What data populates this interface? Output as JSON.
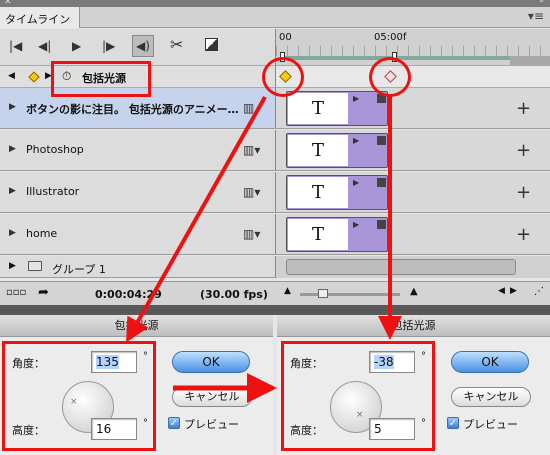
{
  "panel": {
    "title": "タイムライン",
    "menu_icon": "panel-menu-icon"
  },
  "controls": {
    "icons": [
      "go-first-icon",
      "step-back-icon",
      "play-icon",
      "step-forward-icon",
      "audio-icon",
      "cut-icon",
      "transition-icon"
    ]
  },
  "ruler": {
    "start": "00",
    "mark": "05:00f"
  },
  "property_row": {
    "label": "包括光源"
  },
  "layers": [
    {
      "name": "ボタンの影に注目。 包括光源のアニメー…",
      "selected": true,
      "thumb": "T"
    },
    {
      "name": "Photoshop",
      "selected": false,
      "thumb": "T"
    },
    {
      "name": "Illustrator",
      "selected": false,
      "thumb": "T"
    },
    {
      "name": "home",
      "selected": false,
      "thumb": "T"
    }
  ],
  "group": {
    "name": "グループ 1"
  },
  "status": {
    "time": "0:00:04:29",
    "fps": "(30.00 fps)"
  },
  "dialog_left": {
    "title": "包括光源",
    "angle_label": "角度：",
    "angle_value": "135",
    "altitude_label": "高度：",
    "altitude_value": "16",
    "degree": "°",
    "ok": "OK",
    "cancel": "キャンセル",
    "preview": "プレビュー"
  },
  "dialog_right": {
    "title": "包括光源",
    "angle_label": "角度：",
    "angle_value": "-38",
    "altitude_label": "高度：",
    "altitude_value": "5",
    "degree": "°",
    "ok": "OK",
    "cancel": "キャンセル",
    "preview": "プレビュー"
  },
  "colors": {
    "annotation": "#ee1111",
    "clip": "#a896d8",
    "selected_row": "#c6d3ec",
    "keyframe": "#ffcc00"
  }
}
